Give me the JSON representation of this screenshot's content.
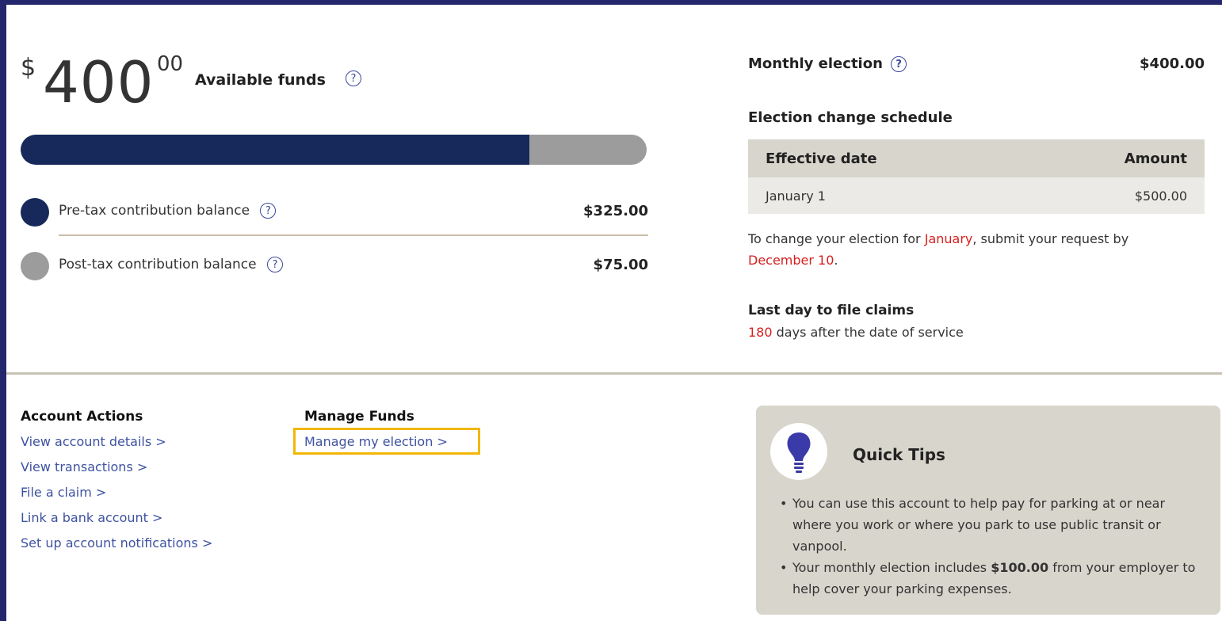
{
  "balance": {
    "currency_symbol": "$",
    "whole": "400",
    "cents": "00",
    "label": "Available funds",
    "pretax_fraction": 0.8125
  },
  "legend": [
    {
      "label": "Pre-tax contribution balance",
      "value": "$325.00",
      "color": "#17295a"
    },
    {
      "label": "Post-tax contribution balance",
      "value": "$75.00",
      "color": "#9c9c9c"
    }
  ],
  "help_icon_glyph": "?",
  "election": {
    "monthly_label": "Monthly election",
    "monthly_value": "$400.00",
    "schedule_title": "Election change schedule",
    "columns": [
      "Effective date",
      "Amount"
    ],
    "rows": [
      {
        "date": "January 1",
        "amount": "$500.00"
      }
    ],
    "note_prefix": "To change your election for ",
    "note_month": "January",
    "note_middle": ", submit your request by ",
    "note_deadline": "December 10",
    "note_suffix": "."
  },
  "claims": {
    "title": "Last day to file claims",
    "days": "180",
    "text": " days after the date of service"
  },
  "account_actions": {
    "title": "Account Actions",
    "links": [
      "View account details >",
      "View transactions >",
      "File a claim >",
      "Link a bank account >",
      "Set up account notifications >"
    ]
  },
  "manage_funds": {
    "title": "Manage Funds",
    "links": [
      "Manage my election >"
    ]
  },
  "quick_tips": {
    "title": "Quick Tips",
    "icon": "lightbulb-icon",
    "tip1": "You can use this account to help pay for parking at or near where you work or where you park to use public transit or vanpool.",
    "tip2_prefix": "Your monthly election includes ",
    "tip2_amount": "$100.00",
    "tip2_suffix": " from your employer to help cover your parking expenses."
  },
  "colors": {
    "frame": "#24276b",
    "accent_dark": "#17295a",
    "link": "#3e52a0",
    "highlight": "#f2b705",
    "alert_red": "#d62020"
  }
}
